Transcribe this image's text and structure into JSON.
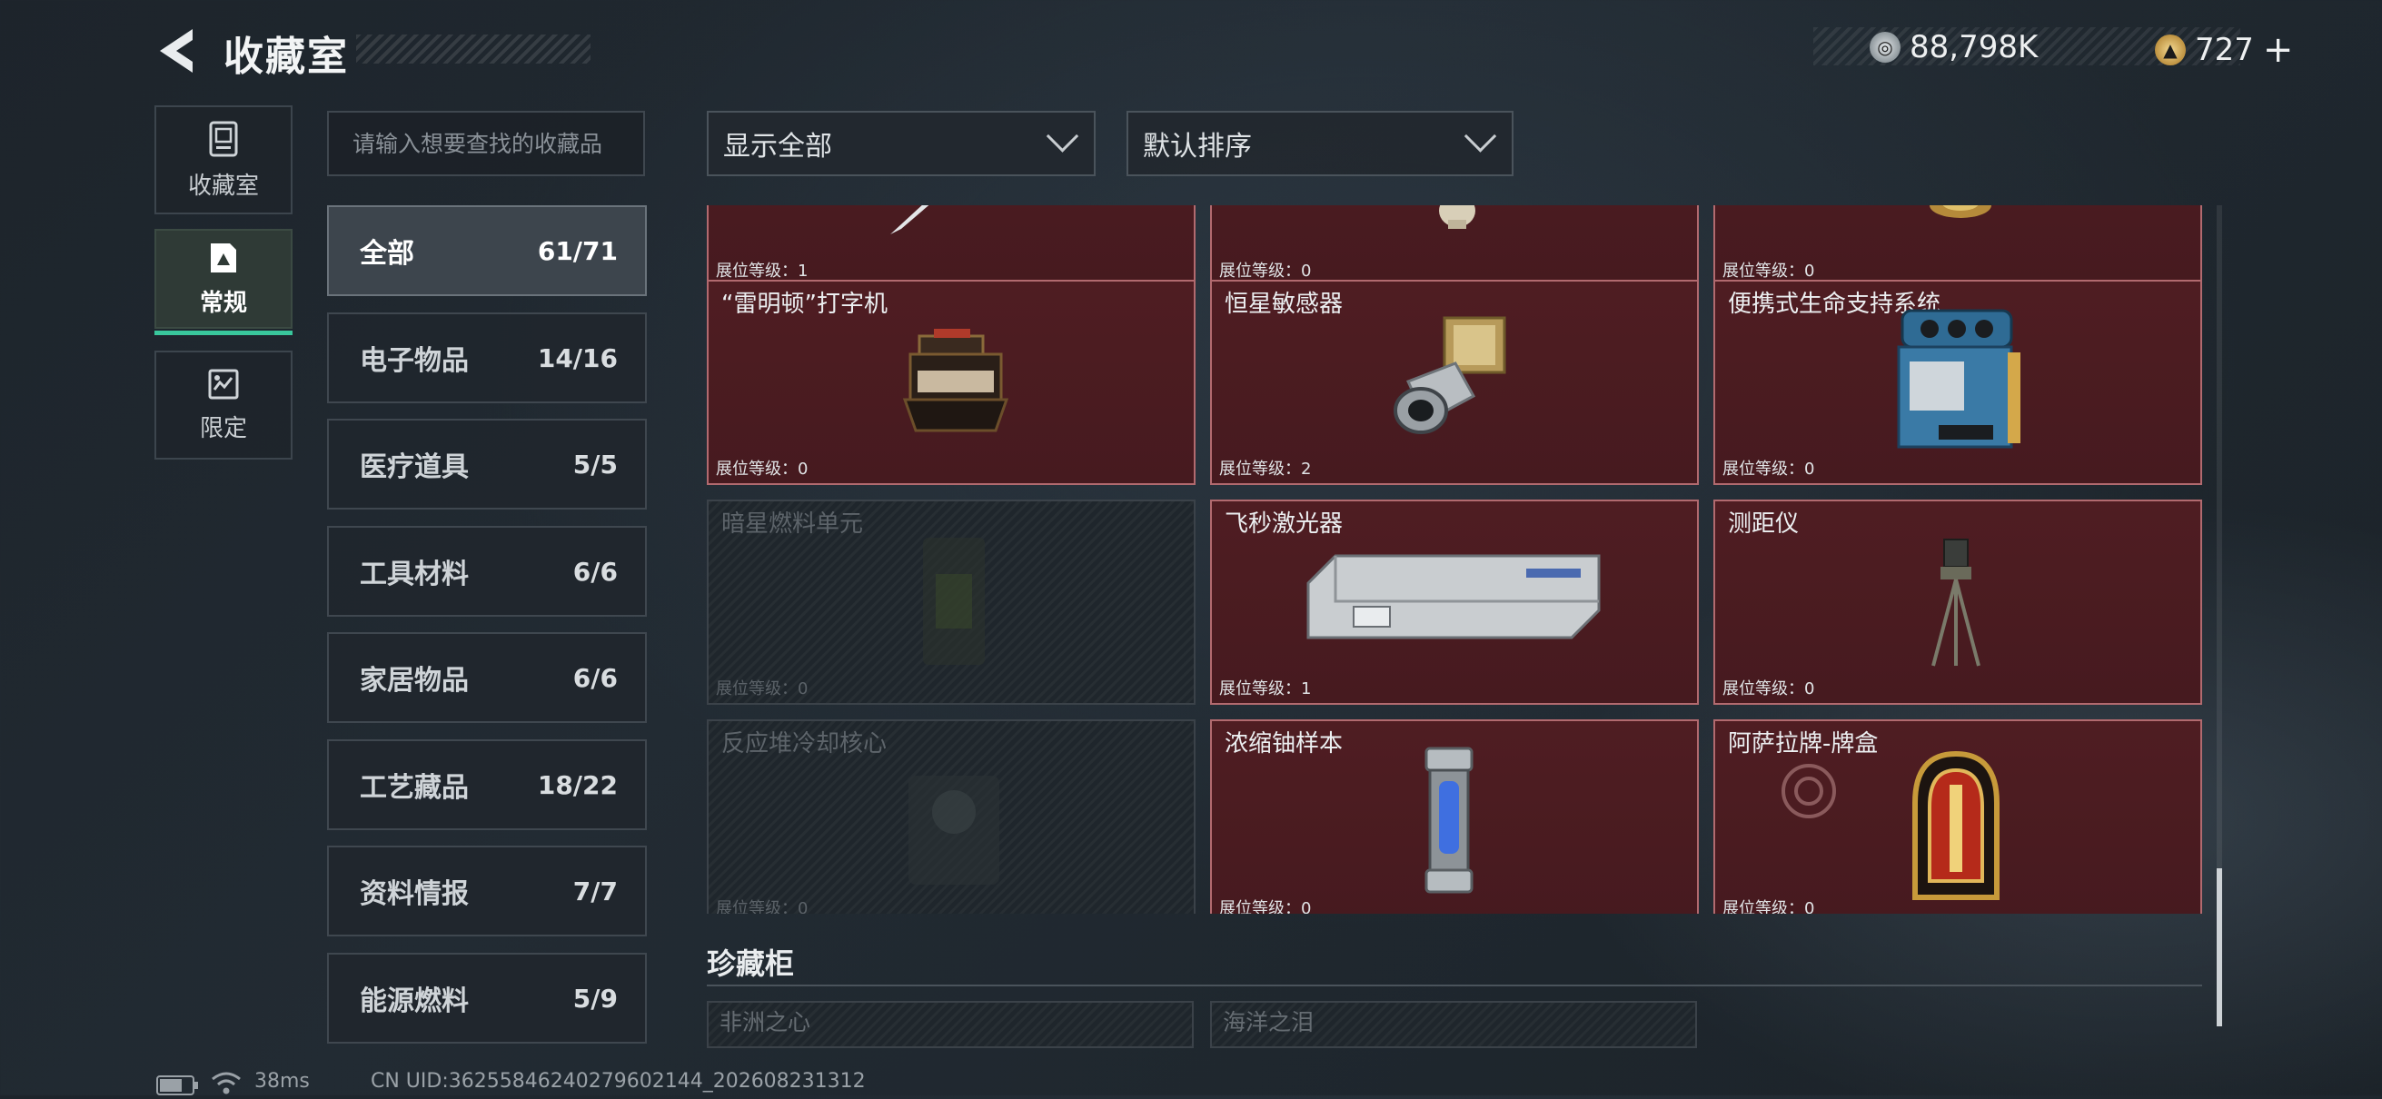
{
  "header": {
    "title": "收藏室",
    "currency": [
      {
        "icon": "silver-coin-icon",
        "value": "88,798K",
        "color": "#9aa3a8"
      },
      {
        "icon": "gold-triangle-coin-icon",
        "value": "727",
        "color": "#d6b25e"
      }
    ],
    "add_label": "+"
  },
  "left_nav": [
    {
      "label": "收藏室",
      "icon": "collection-room-icon",
      "active": false
    },
    {
      "label": "常规",
      "icon": "regular-icon",
      "active": true
    },
    {
      "label": "限定",
      "icon": "limited-icon",
      "active": false
    }
  ],
  "search": {
    "placeholder": "请输入想要查找的收藏品"
  },
  "categories": [
    {
      "name": "全部",
      "count": "61/71",
      "active": true
    },
    {
      "name": "电子物品",
      "count": "14/16"
    },
    {
      "name": "医疗道具",
      "count": "5/5"
    },
    {
      "name": "工具材料",
      "count": "6/6"
    },
    {
      "name": "家居物品",
      "count": "6/6"
    },
    {
      "name": "工艺藏品",
      "count": "18/22"
    },
    {
      "name": "资料情报",
      "count": "7/7"
    },
    {
      "name": "能源燃料",
      "count": "5/9"
    }
  ],
  "filters": {
    "show": {
      "value": "显示全部",
      "icon": "chevron-down-icon"
    },
    "sort": {
      "value": "默认排序",
      "icon": "chevron-down-icon"
    }
  },
  "level_prefix": "展位等级：",
  "items": [
    {
      "name": "",
      "level": "1",
      "locked": false,
      "icon": "blade-icon"
    },
    {
      "name": "",
      "level": "0",
      "locked": false,
      "icon": "vase-icon"
    },
    {
      "name": "",
      "level": "0",
      "locked": false,
      "icon": "gold-artifact-icon"
    },
    {
      "name": "“雷明顿”打字机",
      "level": "0",
      "locked": false,
      "icon": "typewriter-icon"
    },
    {
      "name": "恒星敏感器",
      "level": "2",
      "locked": false,
      "icon": "star-sensor-icon"
    },
    {
      "name": "便携式生命支持系统",
      "level": "0",
      "locked": false,
      "icon": "life-support-icon"
    },
    {
      "name": "暗星燃料单元",
      "level": "0",
      "locked": true,
      "icon": "fuel-cell-icon"
    },
    {
      "name": "飞秒激光器",
      "level": "1",
      "locked": false,
      "icon": "laser-icon"
    },
    {
      "name": "测距仪",
      "level": "0",
      "locked": false,
      "icon": "rangefinder-icon"
    },
    {
      "name": "反应堆冷却核心",
      "level": "0",
      "locked": true,
      "icon": "reactor-core-icon"
    },
    {
      "name": "浓缩铀样本",
      "level": "0",
      "locked": false,
      "icon": "uranium-sample-icon"
    },
    {
      "name": "阿萨拉牌-牌盒",
      "level": "0",
      "locked": false,
      "icon": "card-box-icon"
    }
  ],
  "treasure": {
    "title": "珍藏柜",
    "items": [
      "非洲之心",
      "海洋之泪"
    ]
  },
  "status_bar": {
    "ping": "38ms",
    "uid": "CN UID:36255846240279602144_202608231312"
  }
}
